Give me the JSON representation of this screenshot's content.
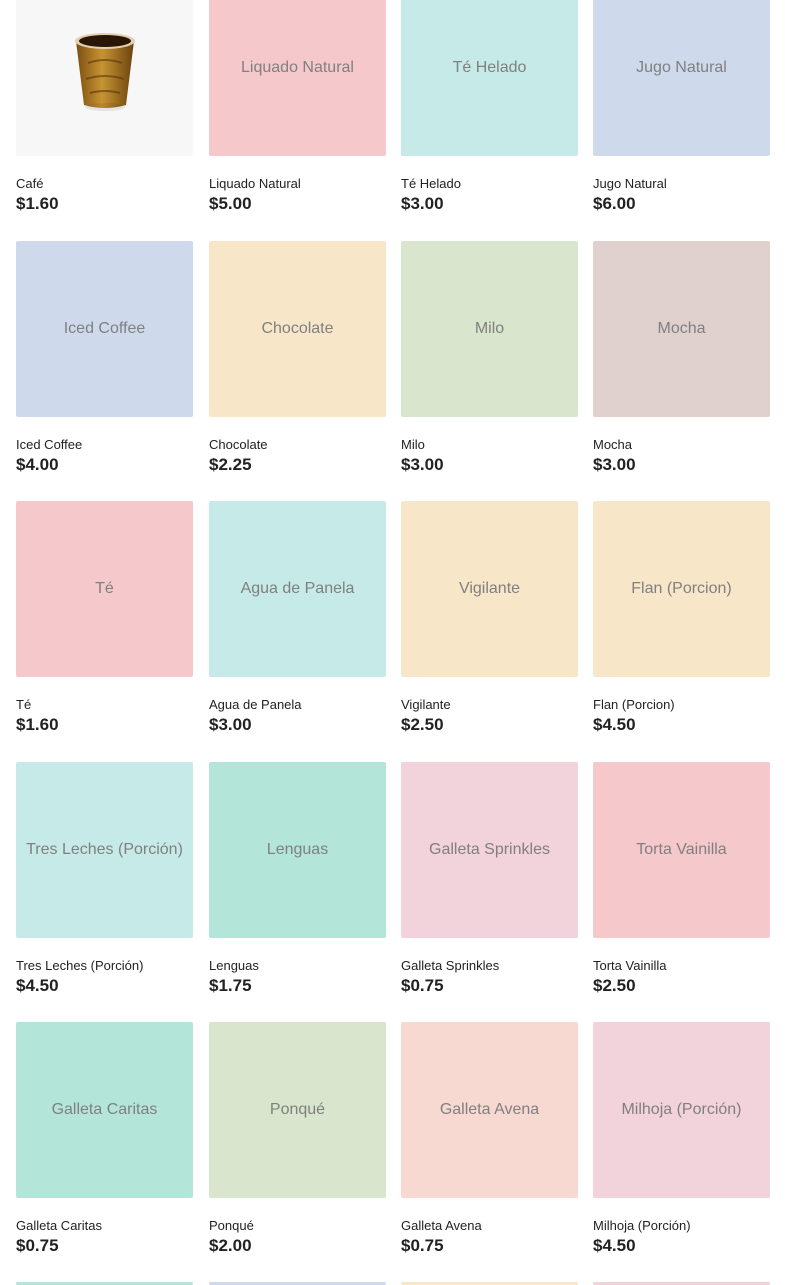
{
  "colors": {
    "pink": "#f5c8cb",
    "teal": "#c6eae7",
    "blue": "#cfd9ec",
    "cream": "#f8e6c9",
    "sage": "#d9e5cc",
    "mauve": "#e0d1cf",
    "mint": "#b3e6d8",
    "rose": "#f2d2db",
    "peach": "#f8d9d2",
    "photo_bg": "#f7f7f7"
  },
  "products": [
    {
      "name": "Café",
      "price": "$1.60",
      "tile_label": "",
      "image": "coffee-cup-photo",
      "color": "photo_bg"
    },
    {
      "name": "Liquado Natural",
      "price": "$5.00",
      "tile_label": "Liquado Natural",
      "color": "pink"
    },
    {
      "name": "Té Helado",
      "price": "$3.00",
      "tile_label": "Té Helado",
      "color": "teal"
    },
    {
      "name": "Jugo Natural",
      "price": "$6.00",
      "tile_label": "Jugo Natural",
      "color": "blue"
    },
    {
      "name": "Iced Coffee",
      "price": "$4.00",
      "tile_label": "Iced Coffee",
      "color": "blue"
    },
    {
      "name": "Chocolate",
      "price": "$2.25",
      "tile_label": "Chocolate",
      "color": "cream"
    },
    {
      "name": "Milo",
      "price": "$3.00",
      "tile_label": "Milo",
      "color": "sage"
    },
    {
      "name": "Mocha",
      "price": "$3.00",
      "tile_label": "Mocha",
      "color": "mauve"
    },
    {
      "name": "Té",
      "price": "$1.60",
      "tile_label": "Té",
      "color": "pink"
    },
    {
      "name": "Agua de Panela",
      "price": "$3.00",
      "tile_label": "Agua de Panela",
      "color": "teal"
    },
    {
      "name": "Vigilante",
      "price": "$2.50",
      "tile_label": "Vigilante",
      "color": "cream"
    },
    {
      "name": "Flan (Porcion)",
      "price": "$4.50",
      "tile_label": "Flan (Porcion)",
      "color": "cream"
    },
    {
      "name": "Tres Leches (Porción)",
      "price": "$4.50",
      "tile_label": "Tres Leches (Porción)",
      "color": "teal"
    },
    {
      "name": "Lenguas",
      "price": "$1.75",
      "tile_label": "Lenguas",
      "color": "mint"
    },
    {
      "name": "Galleta Sprinkles",
      "price": "$0.75",
      "tile_label": "Galleta Sprinkles",
      "color": "rose"
    },
    {
      "name": "Torta Vainilla",
      "price": "$2.50",
      "tile_label": "Torta Vainilla",
      "color": "pink"
    },
    {
      "name": "Galleta Caritas",
      "price": "$0.75",
      "tile_label": "Galleta Caritas",
      "color": "mint"
    },
    {
      "name": "Ponqué",
      "price": "$2.00",
      "tile_label": "Ponqué",
      "color": "sage"
    },
    {
      "name": "Galleta Avena",
      "price": "$0.75",
      "tile_label": "Galleta Avena",
      "color": "peach"
    },
    {
      "name": "Milhoja (Porción)",
      "price": "$4.50",
      "tile_label": "Milhoja (Porción)",
      "color": "rose"
    }
  ],
  "partial_next_row_colors": [
    "mint",
    "blue",
    "cream",
    "rose"
  ]
}
